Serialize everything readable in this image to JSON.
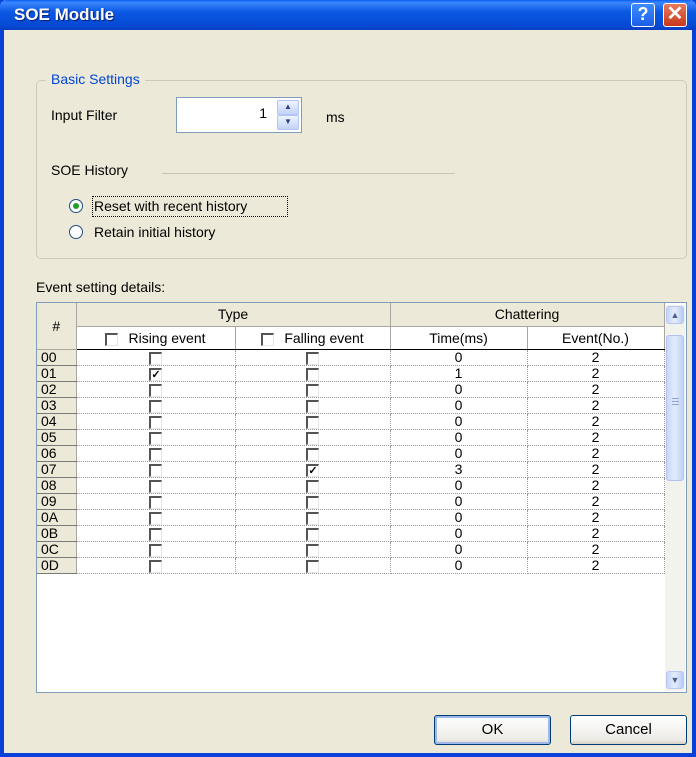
{
  "window": {
    "title": "SOE Module"
  },
  "titlebar_buttons": {
    "help": "?",
    "close": "✕"
  },
  "basic_settings": {
    "legend": "Basic Settings",
    "input_filter_label": "Input Filter",
    "input_filter_value": "1",
    "unit": "ms",
    "soe_history_label": "SOE History",
    "options": [
      {
        "label": "Reset with recent history",
        "checked": true
      },
      {
        "label": "Retain initial history",
        "checked": false
      }
    ]
  },
  "event_details": {
    "label": "Event setting details:",
    "columns": {
      "number": "#",
      "type_group": "Type",
      "rising": "Rising event",
      "falling": "Falling event",
      "chattering_group": "Chattering",
      "time": "Time(ms)",
      "event": "Event(No.)"
    },
    "rows": [
      {
        "id": "00",
        "rising": false,
        "falling": false,
        "time": "0",
        "event": "2"
      },
      {
        "id": "01",
        "rising": true,
        "falling": false,
        "time": "1",
        "event": "2"
      },
      {
        "id": "02",
        "rising": false,
        "falling": false,
        "time": "0",
        "event": "2"
      },
      {
        "id": "03",
        "rising": false,
        "falling": false,
        "time": "0",
        "event": "2"
      },
      {
        "id": "04",
        "rising": false,
        "falling": false,
        "time": "0",
        "event": "2"
      },
      {
        "id": "05",
        "rising": false,
        "falling": false,
        "time": "0",
        "event": "2"
      },
      {
        "id": "06",
        "rising": false,
        "falling": false,
        "time": "0",
        "event": "2"
      },
      {
        "id": "07",
        "rising": false,
        "falling": true,
        "time": "3",
        "event": "2"
      },
      {
        "id": "08",
        "rising": false,
        "falling": false,
        "time": "0",
        "event": "2"
      },
      {
        "id": "09",
        "rising": false,
        "falling": false,
        "time": "0",
        "event": "2"
      },
      {
        "id": "0A",
        "rising": false,
        "falling": false,
        "time": "0",
        "event": "2"
      },
      {
        "id": "0B",
        "rising": false,
        "falling": false,
        "time": "0",
        "event": "2"
      },
      {
        "id": "0C",
        "rising": false,
        "falling": false,
        "time": "0",
        "event": "2"
      },
      {
        "id": "0D",
        "rising": false,
        "falling": false,
        "time": "0",
        "event": "2"
      }
    ]
  },
  "buttons": {
    "ok": "OK",
    "cancel": "Cancel"
  },
  "icons": {
    "spin_up": "▲",
    "spin_down": "▼",
    "scroll_up": "▲",
    "scroll_down": "▼",
    "check": "✓"
  },
  "colors": {
    "title_bar": "#0b58e3",
    "dialog_bg": "#ece9d8",
    "group_legend": "#0046d5",
    "radio_dot": "#21a121"
  }
}
